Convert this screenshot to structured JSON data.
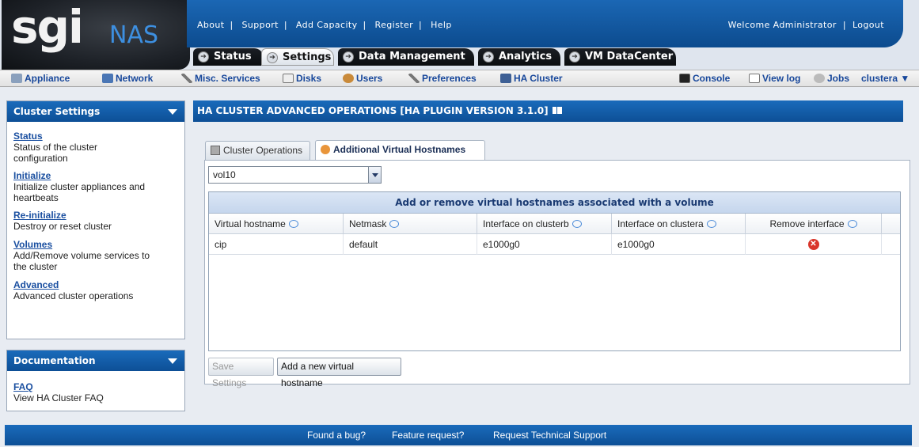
{
  "brand": {
    "logo_text": "sgi",
    "product": "NAS"
  },
  "top_links": [
    "About",
    "Support",
    "Add Capacity",
    "Register",
    "Help"
  ],
  "user": {
    "welcome": "Welcome Administrator",
    "logout": "Logout"
  },
  "main_tabs": [
    {
      "label": "Status",
      "active": false
    },
    {
      "label": "Settings",
      "active": true
    },
    {
      "label": "Data Management",
      "active": false
    },
    {
      "label": "Analytics",
      "active": false
    },
    {
      "label": "VM DataCenter",
      "active": false
    }
  ],
  "sub_nav": {
    "items": [
      "Appliance",
      "Network",
      "Misc. Services",
      "Disks",
      "Users",
      "Preferences",
      "HA Cluster"
    ],
    "active": "HA Cluster",
    "right": [
      "Console",
      "View log",
      "Jobs",
      "clustera ▼"
    ]
  },
  "sidebar": {
    "cluster_settings": {
      "title": "Cluster Settings",
      "items": [
        {
          "title": "Status",
          "desc1": "Status of the cluster",
          "desc2": "configuration"
        },
        {
          "title": "Initialize",
          "desc1": "Initialize cluster appliances and",
          "desc2": "heartbeats"
        },
        {
          "title": "Re-initialize",
          "desc1": "Destroy or reset cluster",
          "desc2": ""
        },
        {
          "title": "Volumes",
          "desc1": "Add/Remove volume services to",
          "desc2": "the cluster"
        },
        {
          "title": "Advanced",
          "desc1": "Advanced cluster operations",
          "desc2": ""
        }
      ]
    },
    "documentation": {
      "title": "Documentation",
      "items": [
        {
          "title": "FAQ",
          "desc1": "View HA Cluster FAQ"
        }
      ]
    }
  },
  "content": {
    "title": "HA CLUSTER ADVANCED OPERATIONS [HA PLUGIN VERSION 3.1.0]",
    "tabs": [
      {
        "label": "Cluster Operations",
        "active": false
      },
      {
        "label": "Additional Virtual Hostnames",
        "active": true
      }
    ],
    "volume_select": {
      "value": "vol10"
    },
    "grid": {
      "caption": "Add or remove virtual hostnames associated with a volume",
      "columns": [
        "Virtual hostname",
        "Netmask",
        "Interface on clusterb",
        "Interface on clustera",
        "Remove interface"
      ],
      "rows": [
        {
          "hostname": "cip",
          "netmask": "default",
          "iface_b": "e1000g0",
          "iface_a": "e1000g0"
        }
      ]
    },
    "buttons": {
      "save": "Save Settings",
      "add": "Add a new virtual hostname"
    }
  },
  "footer": {
    "links": [
      "Found a bug?",
      "Feature request?",
      "Request Technical Support"
    ]
  },
  "colors": {
    "header_blue": "#0d4f96",
    "link_blue": "#1a4fa0",
    "remove_red": "#d9362b"
  }
}
